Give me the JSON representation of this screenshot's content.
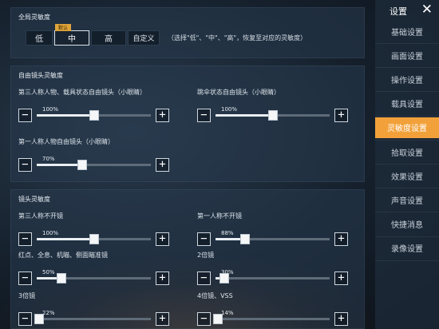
{
  "global": {
    "title": "全局灵敏度",
    "options": [
      "低",
      "中",
      "高",
      "自定义"
    ],
    "selected": "中",
    "default_badge": "默认",
    "hint": "（选择\"低\"、\"中\"、\"高\"，恢复至对应的灵敏度）"
  },
  "free_cam": {
    "title": "自由镜头灵敏度",
    "sliders": [
      {
        "label": "第三人称人物、载具状态自由镜头（小眼睛）",
        "value_text": "100%",
        "level": 0.5
      },
      {
        "label": "跳伞状态自由镜头（小眼睛）",
        "value_text": "100%",
        "level": 0.5
      },
      {
        "label": "第一人称人物自由镜头（小眼睛）",
        "value_text": "70%",
        "level": 0.4
      }
    ]
  },
  "lens": {
    "title": "镜头灵敏度",
    "sliders": [
      {
        "label": "第三人称不开镜",
        "value_text": "100%",
        "level": 0.5
      },
      {
        "label": "第一人称不开镜",
        "value_text": "88%",
        "level": 0.26
      },
      {
        "label": "红点、全息、机瞄、侧面瞄准镜",
        "value_text": "50%",
        "level": 0.22
      },
      {
        "label": "2倍镜",
        "value_text": "30%",
        "level": 0.08
      },
      {
        "label": "3倍镜",
        "value_text": "22%",
        "level": 0.02
      },
      {
        "label": "4倍镜、VSS",
        "value_text": "14%",
        "level": 0.02
      }
    ]
  },
  "controls": {
    "minus": "−",
    "plus": "+"
  },
  "sidebar": {
    "title": "设置",
    "close": "✕",
    "items": [
      "基础设置",
      "画面设置",
      "操作设置",
      "载具设置",
      "灵敏度设置",
      "拾取设置",
      "效果设置",
      "声音设置",
      "快捷消息",
      "录像设置"
    ],
    "active_index": 4
  },
  "colors": {
    "accent": "#f2a13a",
    "badge": "#e0a53a"
  }
}
